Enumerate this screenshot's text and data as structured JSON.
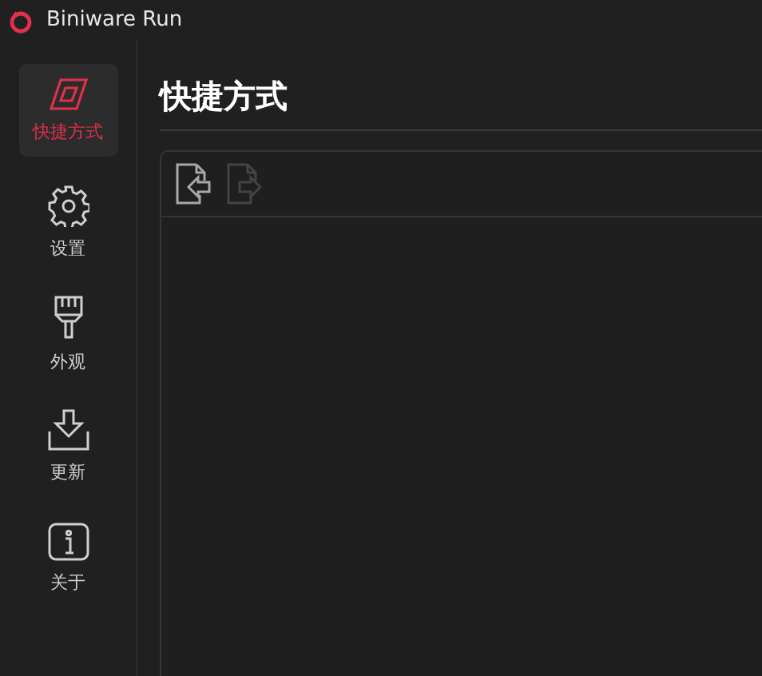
{
  "window": {
    "title": "Biniware Run"
  },
  "sidebar": {
    "items": [
      {
        "kind": "shortcuts",
        "label": "快捷方式",
        "selected": true
      },
      {
        "kind": "settings",
        "label": "设置",
        "selected": false
      },
      {
        "kind": "appearance",
        "label": "外观",
        "selected": false
      },
      {
        "kind": "update",
        "label": "更新",
        "selected": false
      },
      {
        "kind": "about",
        "label": "关于",
        "selected": false
      }
    ]
  },
  "page": {
    "title": "快捷方式"
  },
  "toolbar": [
    {
      "kind": "import",
      "disabled": false
    },
    {
      "kind": "export",
      "disabled": true
    }
  ]
}
